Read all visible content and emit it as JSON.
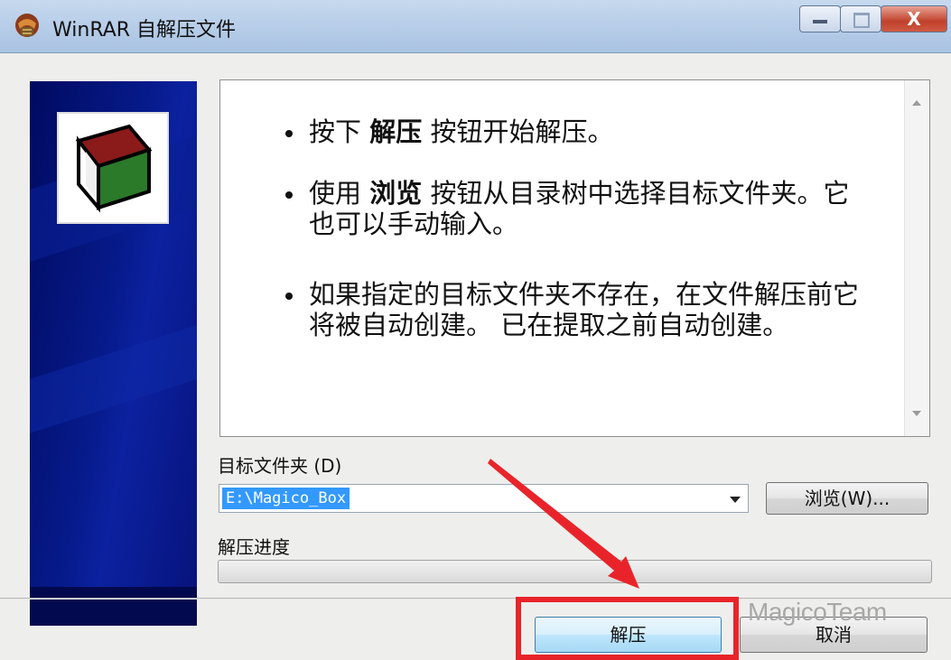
{
  "window": {
    "title": "WinRAR 自解压文件",
    "icon": "winrar-icon",
    "close_glyph": "X"
  },
  "info": {
    "items": [
      {
        "pre": "按下 ",
        "bold": "解压",
        "post": " 按钮开始解压。"
      },
      {
        "pre": "使用 ",
        "bold": "浏览",
        "post": " 按钮从目录树中选择目标文件夹。它也可以手动输入。"
      },
      {
        "pre": "",
        "bold": "",
        "post": "如果指定的目标文件夹不存在，在文件解压前它将被自动创建。 已在提取之前自动创建。"
      }
    ]
  },
  "destination": {
    "label": "目标文件夹 (D)",
    "value": "E:\\Magico_Box",
    "browse_label": "浏览(W)..."
  },
  "progress": {
    "label": "解压进度",
    "value": 0
  },
  "buttons": {
    "extract_label": "解压",
    "cancel_label": "取消"
  },
  "annotations": {
    "watermark": "MagicoTeam",
    "highlight_color": "#e8242a"
  },
  "colors": {
    "banner": "#061a8a",
    "selection": "#3399ff"
  }
}
